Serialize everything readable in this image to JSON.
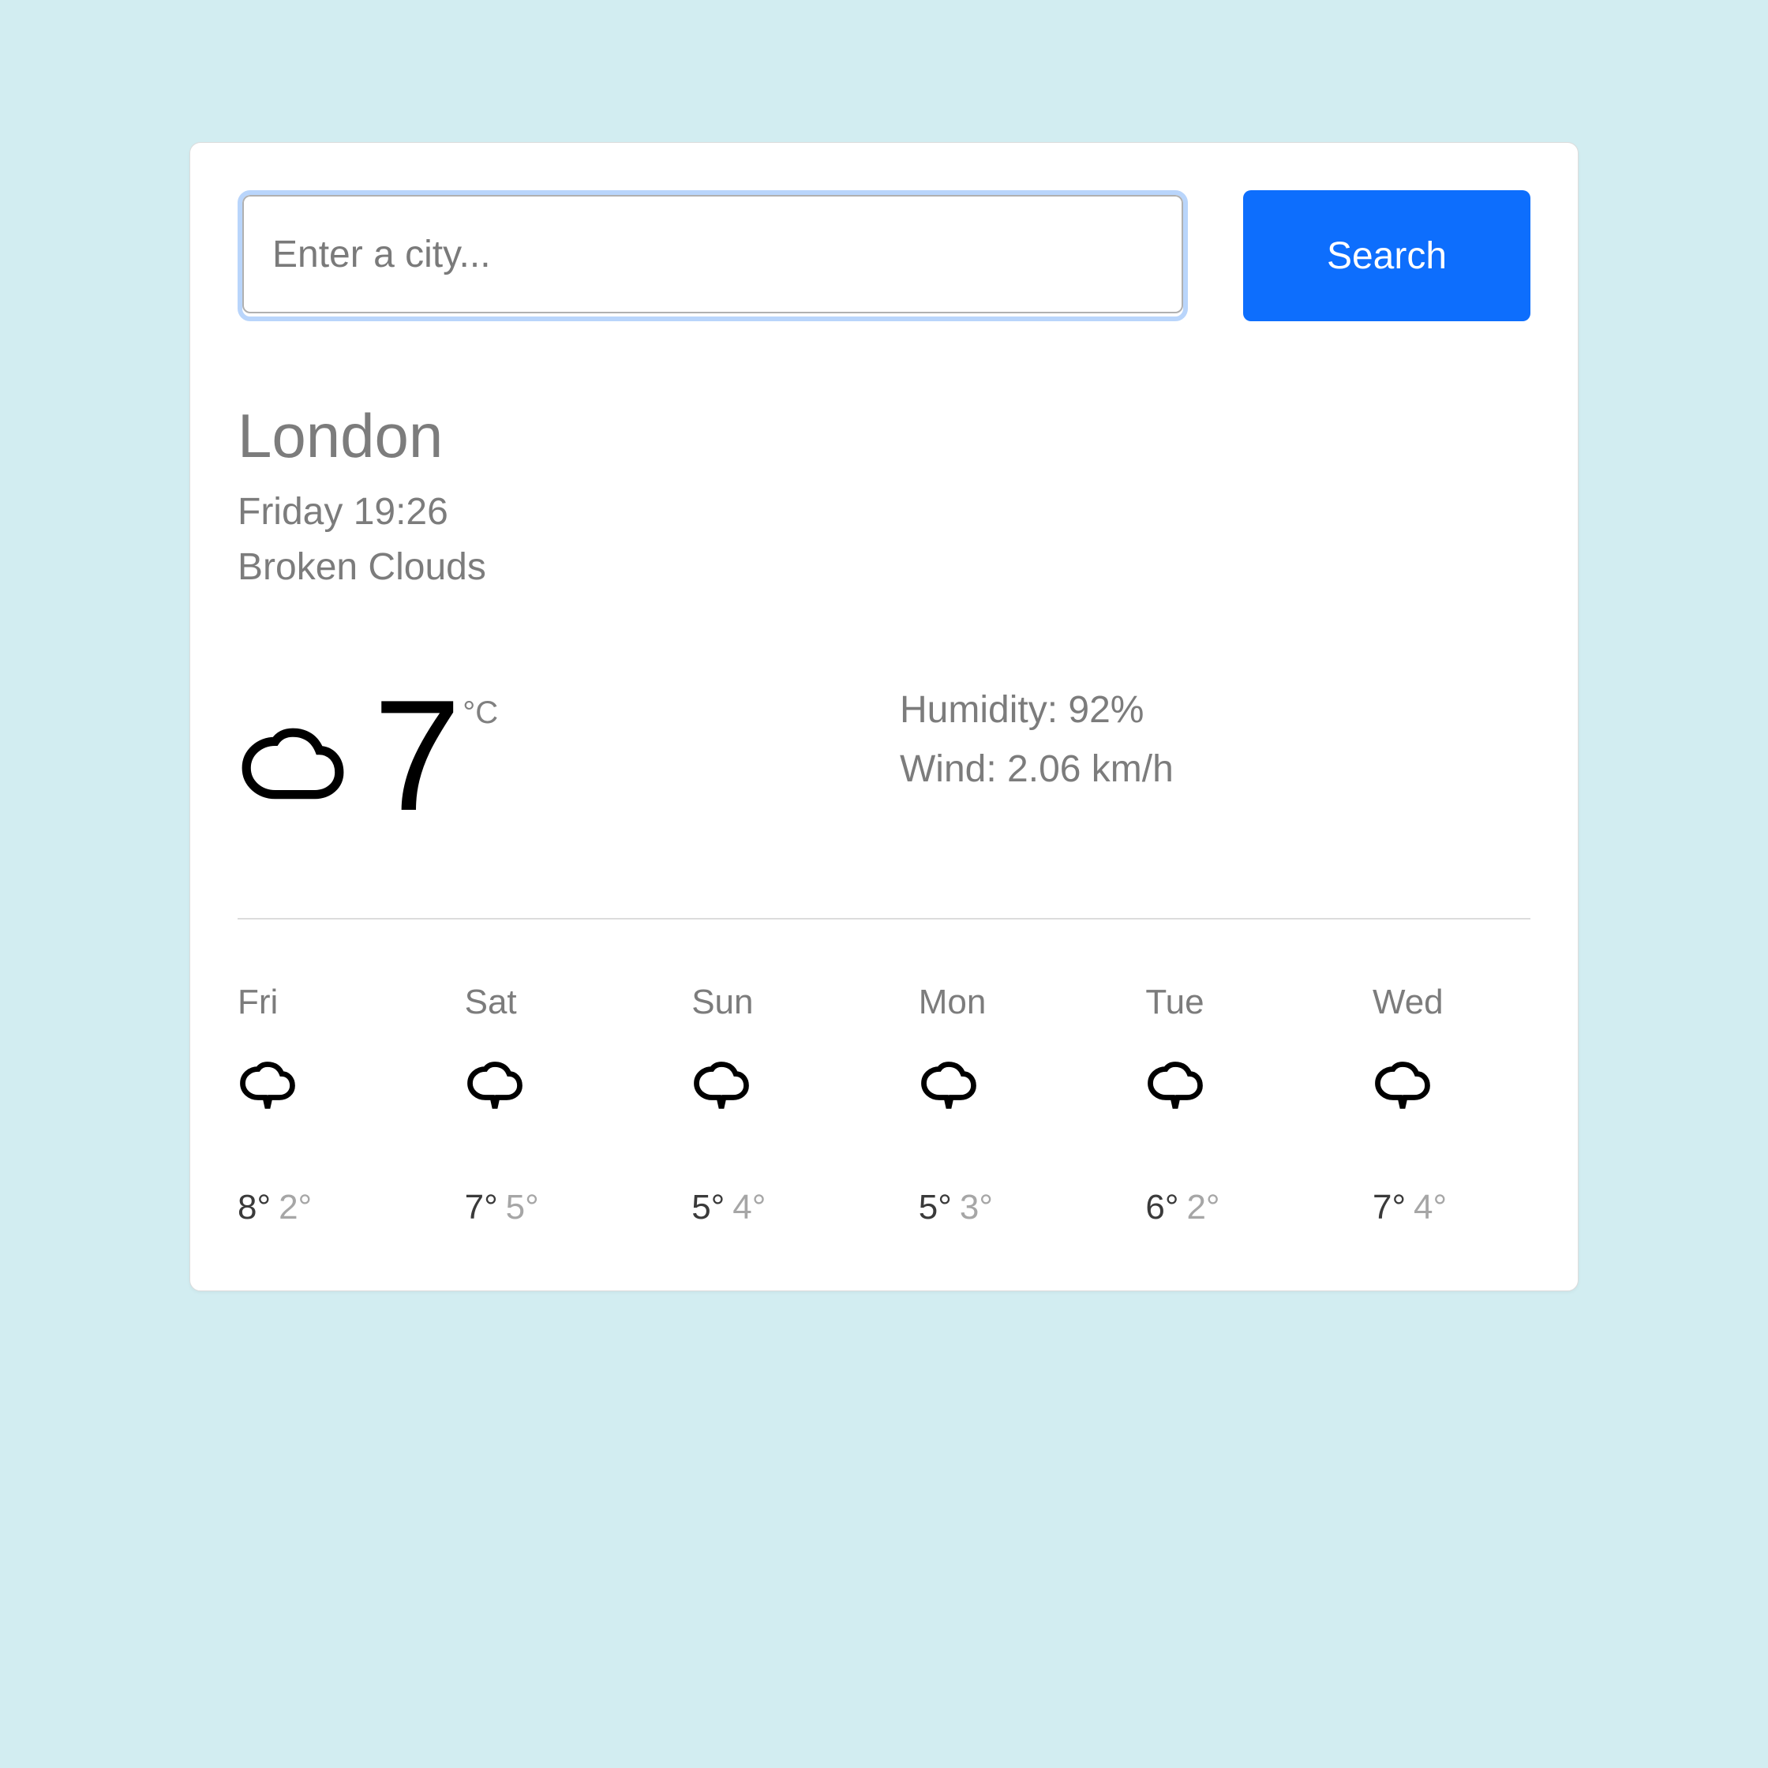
{
  "search": {
    "placeholder": "Enter a city...",
    "value": "",
    "button_label": "Search"
  },
  "current": {
    "city": "London",
    "datetime": "Friday 19:26",
    "condition": "Broken Clouds",
    "icon": "cloud-icon",
    "temperature": "7",
    "unit": "°C",
    "humidity_label": "Humidity: 92%",
    "wind_label": "Wind: 2.06 km/h"
  },
  "forecast": [
    {
      "day": "Fri",
      "icon": "cloud-icon",
      "hi": "8°",
      "lo": "2°"
    },
    {
      "day": "Sat",
      "icon": "cloud-icon",
      "hi": "7°",
      "lo": "5°"
    },
    {
      "day": "Sun",
      "icon": "cloud-icon",
      "hi": "5°",
      "lo": "4°"
    },
    {
      "day": "Mon",
      "icon": "cloud-icon",
      "hi": "5°",
      "lo": "3°"
    },
    {
      "day": "Tue",
      "icon": "cloud-icon",
      "hi": "6°",
      "lo": "2°"
    },
    {
      "day": "Wed",
      "icon": "cloud-icon",
      "hi": "7°",
      "lo": "4°"
    }
  ]
}
